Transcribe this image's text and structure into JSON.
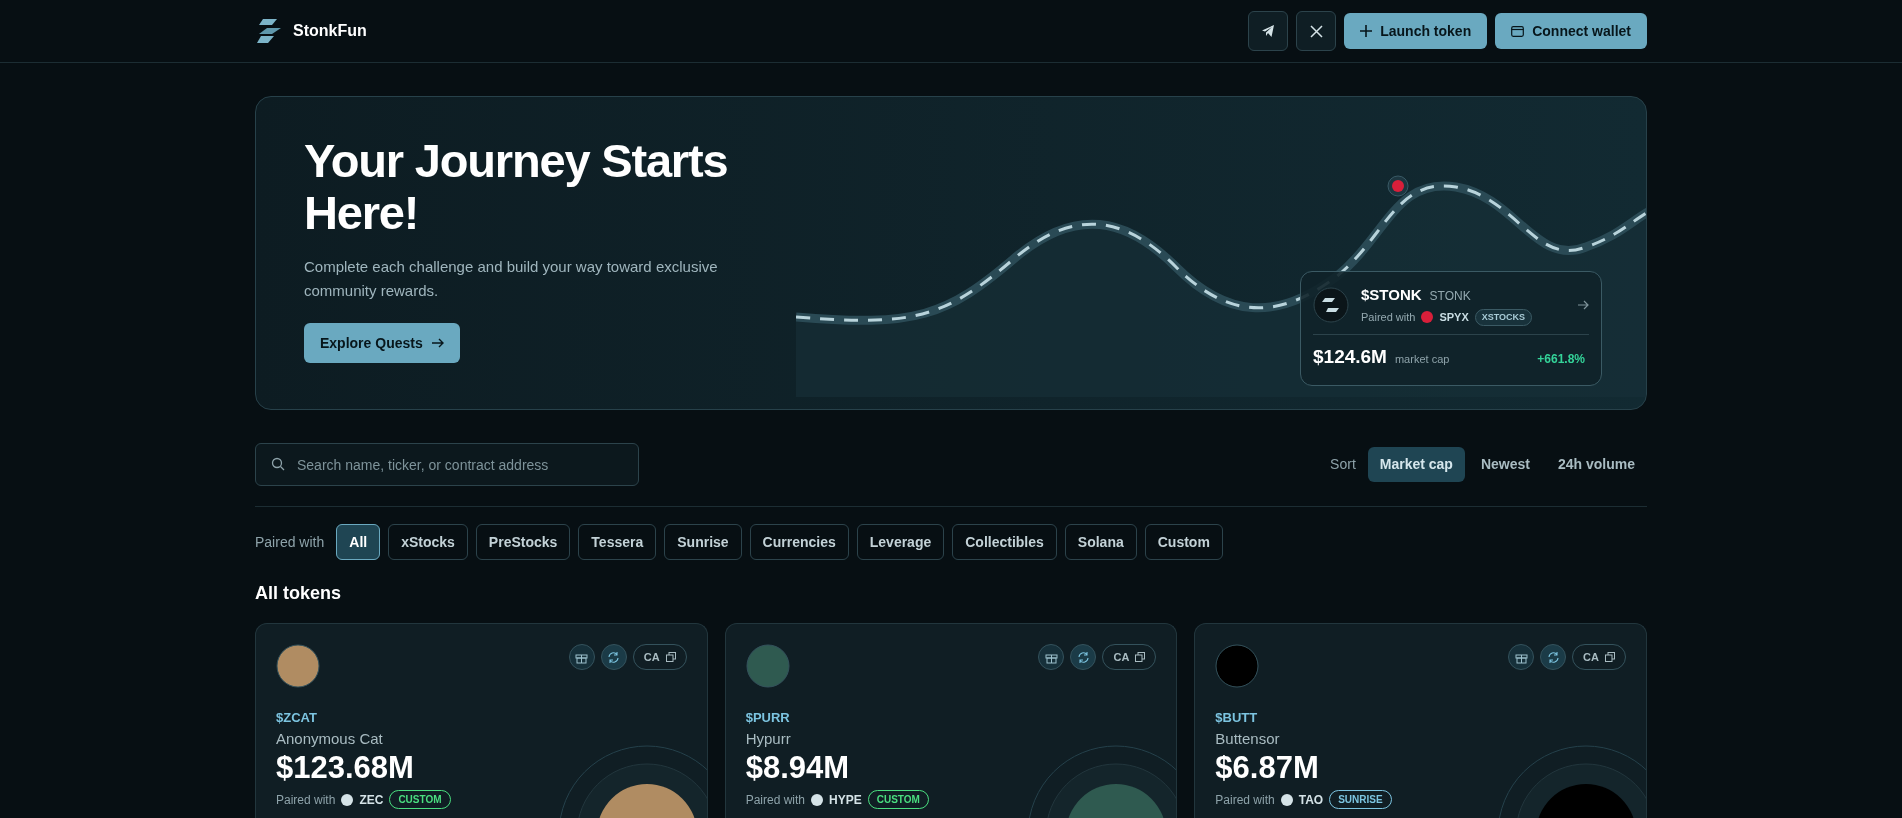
{
  "header": {
    "brand": "StonkFun",
    "buttons": [
      {
        "kind": "telegram"
      },
      {
        "kind": "x"
      },
      {
        "kind": "launch",
        "label": "Launch token"
      },
      {
        "kind": "wallet",
        "label": "Connect wallet"
      }
    ]
  },
  "hero": {
    "title": "Your Journey Starts Here!",
    "description": "Complete each challenge and build your way toward exclusive community rewards.",
    "button": "Explore Quests",
    "featured": {
      "ticker": "$STONK",
      "name": "STONK",
      "paired_label": "Paired with",
      "pair_symbol": "SPYX",
      "pair_tag": "XSTOCKS",
      "market_cap": "$124.6M",
      "market_cap_label": "market cap",
      "change": "+661.8%"
    }
  },
  "search": {
    "placeholder": "Search name, ticker, or contract address"
  },
  "sort": {
    "label": "Sort",
    "options": [
      {
        "label": "Market cap",
        "selected": true
      },
      {
        "label": "Newest",
        "selected": false
      },
      {
        "label": "24h volume",
        "selected": false
      }
    ]
  },
  "filters": {
    "label": "Paired with",
    "options": [
      {
        "label": "All",
        "selected": true
      },
      {
        "label": "xStocks",
        "selected": false
      },
      {
        "label": "PreStocks",
        "selected": false
      },
      {
        "label": "Tessera",
        "selected": false
      },
      {
        "label": "Sunrise",
        "selected": false
      },
      {
        "label": "Currencies",
        "selected": false
      },
      {
        "label": "Leverage",
        "selected": false
      },
      {
        "label": "Collectibles",
        "selected": false
      },
      {
        "label": "Solana",
        "selected": false
      },
      {
        "label": "Custom",
        "selected": false
      }
    ]
  },
  "section_title": "All tokens",
  "tokens": [
    {
      "ticker": "$ZCAT",
      "name": "Anonymous Cat",
      "market_cap": "$123.68M",
      "ca_label": "CA",
      "paired_label": "Paired with",
      "pair_symbol": "ZEC",
      "tag": "CUSTOM",
      "color": "#4ade80"
    },
    {
      "ticker": "$PURR",
      "name": "Hypurr",
      "market_cap": "$8.94M",
      "ca_label": "CA",
      "paired_label": "Paired with",
      "pair_symbol": "HYPE",
      "tag": "CUSTOM",
      "color": "#4ade80"
    },
    {
      "ticker": "$BUTT",
      "name": "Buttensor",
      "market_cap": "$6.87M",
      "ca_label": "CA",
      "paired_label": "Paired with",
      "pair_symbol": "TAO",
      "tag": "SUNRISE",
      "color": "#7cc4e0"
    }
  ]
}
